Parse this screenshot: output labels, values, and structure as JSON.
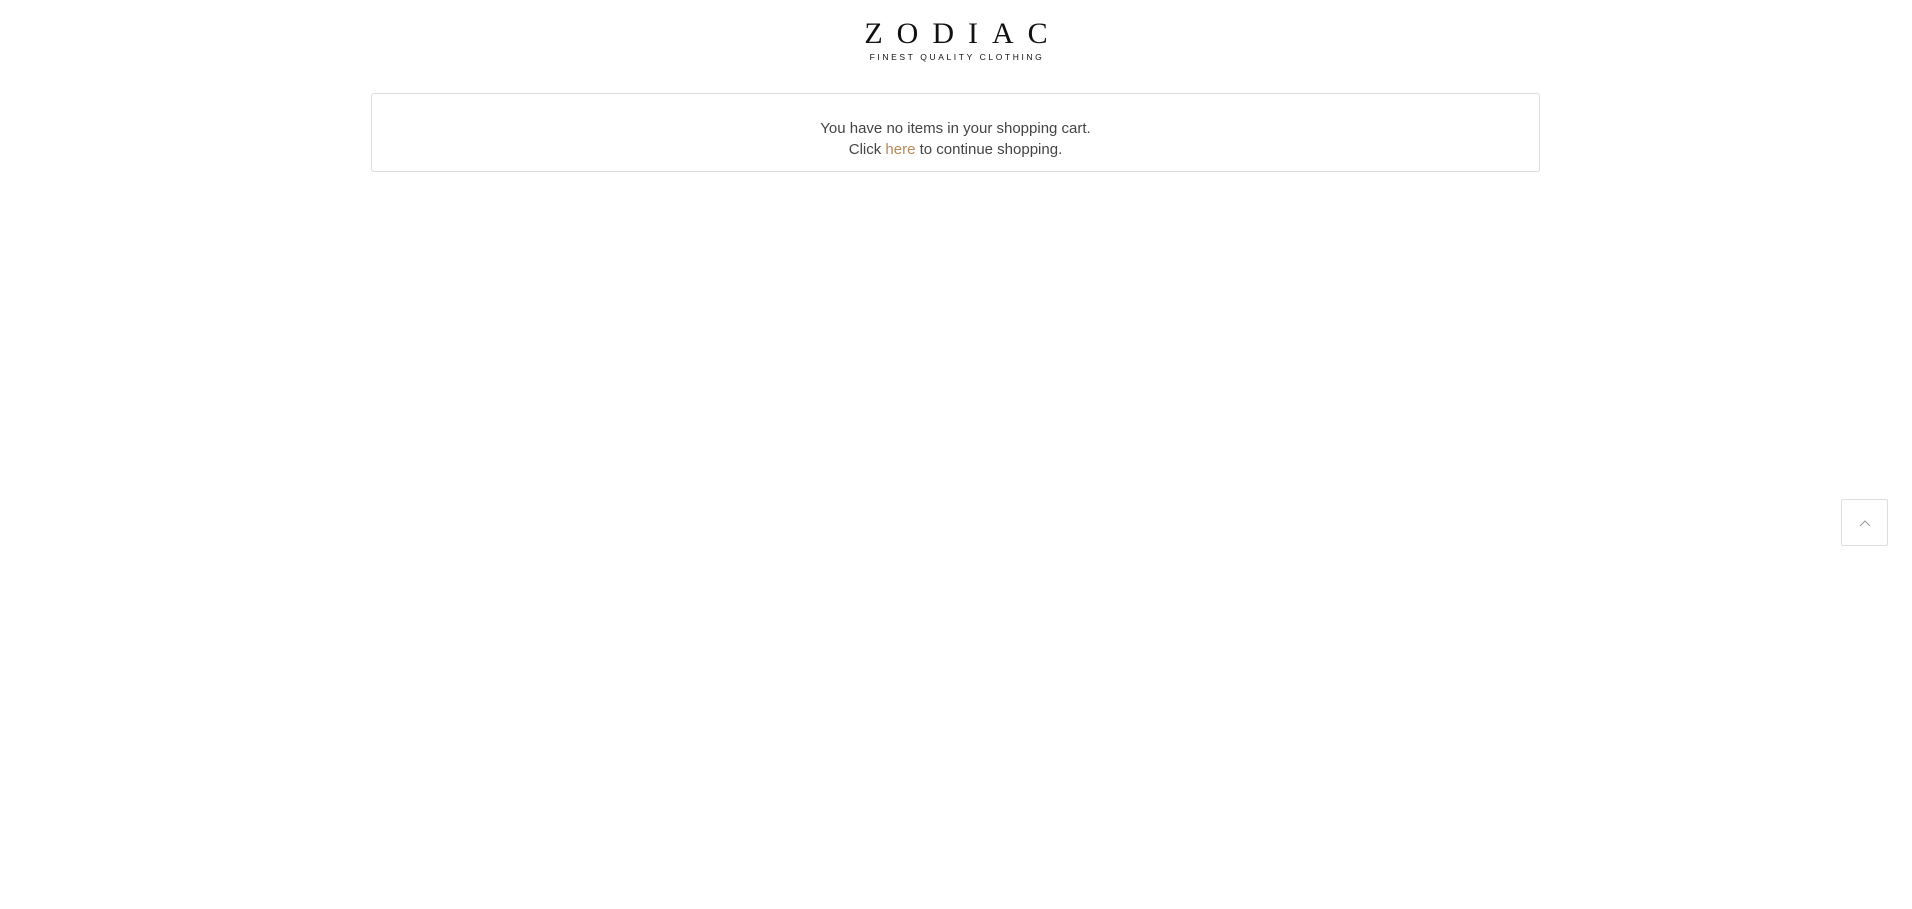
{
  "header": {
    "logo": {
      "name": "ZODIAC",
      "tagline": "FINEST QUALITY CLOTHING"
    }
  },
  "cart": {
    "empty_message": "You have no items in your shopping cart.",
    "continue_prefix": "Click ",
    "continue_link": "here",
    "continue_suffix": " to continue shopping."
  },
  "back_to_top": {
    "icon": "chevron-up-icon"
  },
  "colors": {
    "link": "#b7895a",
    "text": "#444444",
    "border": "#dcdcdc"
  }
}
